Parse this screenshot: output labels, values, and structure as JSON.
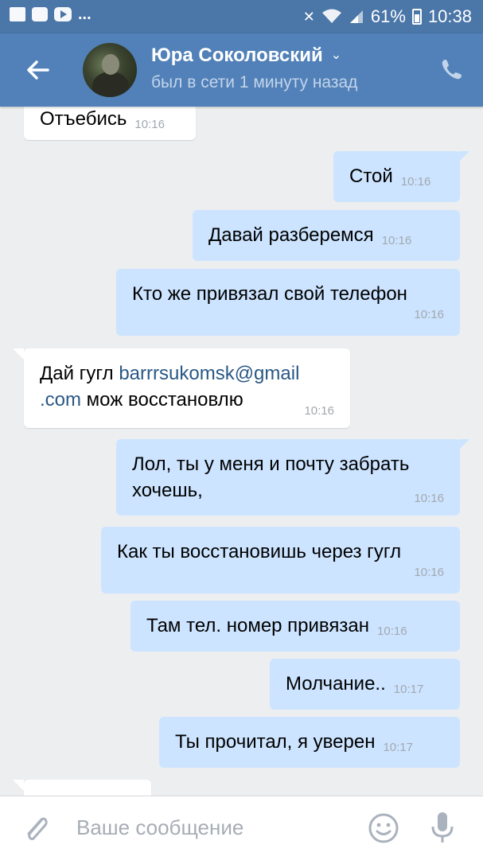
{
  "status_bar": {
    "left_dots": "...",
    "battery": "61%",
    "time": "10:38"
  },
  "header": {
    "name": "Юра Соколовский",
    "status": "был в сети 1 минуту назад"
  },
  "messages": [
    {
      "text": "Отъебись",
      "time": "10:16"
    },
    {
      "text": "Стой",
      "time": "10:16"
    },
    {
      "text": "Давай разберемся",
      "time": "10:16"
    },
    {
      "text": "Кто же привязал свой телефон",
      "time": "10:16"
    },
    {
      "text_before": "Дай гугл ",
      "link_1": "barrrsukomsk@gmail",
      "link_2": ".com",
      "text_after": " мож восстановлю",
      "time": "10:16"
    },
    {
      "text": "Лол, ты у меня и почту забрать хочешь,",
      "time": "10:16"
    },
    {
      "text": "Как ты восстановишь через гугл",
      "time": "10:16"
    },
    {
      "text": "Там тел. номер привязан",
      "time": "10:16"
    },
    {
      "text": "Молчание..",
      "time": "10:17"
    },
    {
      "text": "Ты прочитал, я уверен",
      "time": "10:17"
    }
  ],
  "input": {
    "placeholder": "Ваше сообщение"
  }
}
